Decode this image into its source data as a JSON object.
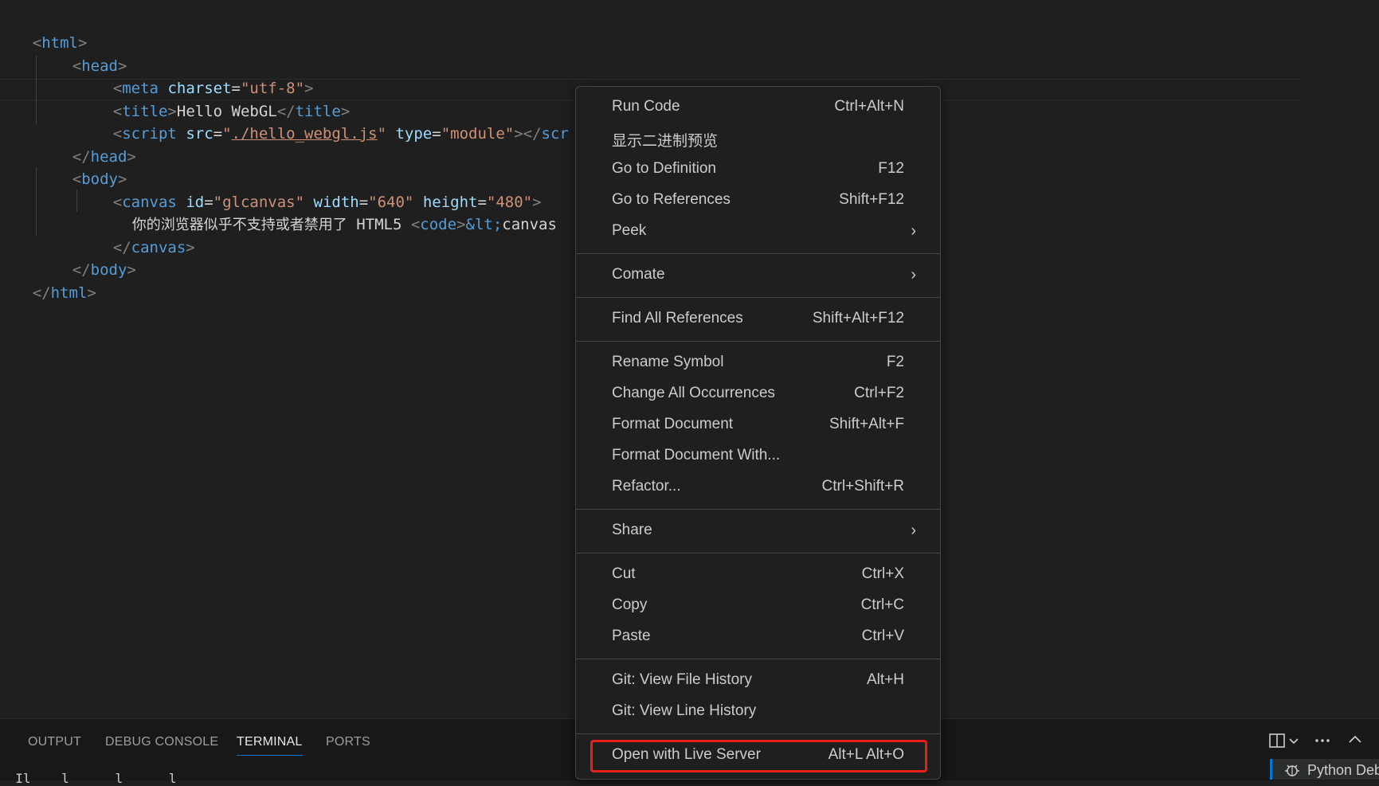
{
  "code": {
    "lines": [
      {
        "t1": "<",
        "tag": "html",
        "t2": ">"
      },
      {
        "t1": "<",
        "tag": "head",
        "t2": ">"
      },
      {
        "t1": "<",
        "tag": "meta",
        "a1": "charset",
        "eq": "=",
        "s1": "\"utf-8\"",
        "t2": ">"
      },
      {
        "t1": "<",
        "tag": "title",
        "t2": ">",
        "text": "Hello WebGL",
        "t3": "</",
        "tag2": "title",
        "t4": ">"
      },
      {
        "t1": "<",
        "tag": "script",
        "a1": "src",
        "eq": "=",
        "q1": "\"",
        "link": "./hello_webgl.js",
        "q2": "\"",
        "a2": "type",
        "eq2": "=",
        "s2": "\"module\"",
        "t2": "></",
        "tag2": "scr"
      },
      {
        "t1": "</",
        "tag": "head",
        "t2": ">"
      },
      {
        "t1": "<",
        "tag": "body",
        "t2": ">"
      },
      {
        "t1": "<",
        "tag": "canvas",
        "a1": "id",
        "eq": "=",
        "s1": "\"glcanvas\"",
        "a2": "width",
        "eq2": "=",
        "s2": "\"640\"",
        "a3": "height",
        "eq3": "=",
        "s3": "\"480\"",
        "t2": ">"
      },
      {
        "cjk": "你的浏览器似乎不支持或者禁用了",
        "text": " HTML5 ",
        "t1": "<",
        "tag": "code",
        "t2": ">",
        "ent": "&lt;",
        "text2": "canvas"
      },
      {
        "t1": "</",
        "tag": "canvas",
        "t2": ">"
      },
      {
        "t1": "</",
        "tag": "body",
        "t2": ">"
      },
      {
        "t1": "</",
        "tag": "html",
        "t2": ">"
      }
    ]
  },
  "panel": {
    "tabs": [
      "OUTPUT",
      "DEBUG CONSOLE",
      "TERMINAL",
      "PORTS"
    ],
    "active_tab": "TERMINAL",
    "terminal_text": "  Il    l      l      l",
    "debug_label": "Python Deb"
  },
  "context_menu": {
    "groups": [
      [
        {
          "label": "Run Code",
          "shortcut": "Ctrl+Alt+N"
        },
        {
          "label": "显示二进制预览",
          "shortcut": ""
        },
        {
          "label": "Go to Definition",
          "shortcut": "F12"
        },
        {
          "label": "Go to References",
          "shortcut": "Shift+F12"
        },
        {
          "label": "Peek",
          "shortcut": "",
          "submenu": "›"
        }
      ],
      [
        {
          "label": "Comate",
          "shortcut": "",
          "submenu": "›"
        }
      ],
      [
        {
          "label": "Find All References",
          "shortcut": "Shift+Alt+F12"
        }
      ],
      [
        {
          "label": "Rename Symbol",
          "shortcut": "F2"
        },
        {
          "label": "Change All Occurrences",
          "shortcut": "Ctrl+F2"
        },
        {
          "label": "Format Document",
          "shortcut": "Shift+Alt+F"
        },
        {
          "label": "Format Document With...",
          "shortcut": ""
        },
        {
          "label": "Refactor...",
          "shortcut": "Ctrl+Shift+R"
        }
      ],
      [
        {
          "label": "Share",
          "shortcut": "",
          "submenu": "›"
        }
      ],
      [
        {
          "label": "Cut",
          "shortcut": "Ctrl+X"
        },
        {
          "label": "Copy",
          "shortcut": "Ctrl+C"
        },
        {
          "label": "Paste",
          "shortcut": "Ctrl+V"
        }
      ],
      [
        {
          "label": "Git: View File History",
          "shortcut": "Alt+H"
        },
        {
          "label": "Git: View Line History",
          "shortcut": ""
        }
      ],
      [
        {
          "label": "Open with Live Server",
          "shortcut": "Alt+L Alt+O",
          "highlighted": true
        }
      ]
    ]
  },
  "colors": {
    "highlight_border": "#e8201a",
    "accent": "#0078d4"
  }
}
